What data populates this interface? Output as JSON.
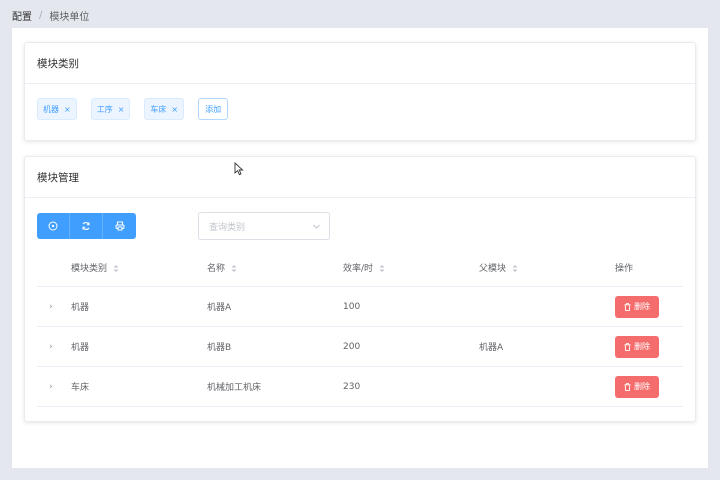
{
  "breadcrumb": {
    "root": "配置",
    "separator": "/",
    "current": "模块单位"
  },
  "category_card": {
    "title": "模块类别",
    "tags": [
      "机器",
      "工序",
      "车床"
    ],
    "add_label": "添加"
  },
  "manage_card": {
    "title": "模块管理",
    "toolbar": {
      "icons": [
        "add-icon",
        "refresh-icon",
        "print-icon"
      ]
    },
    "search": {
      "placeholder": "查询类别"
    },
    "columns": [
      "模块类别",
      "名称",
      "效率/时",
      "父模块",
      "操作"
    ],
    "rows": [
      {
        "category": "机器",
        "name": "机器A",
        "efficiency": "100",
        "parent": "",
        "action": "删除"
      },
      {
        "category": "机器",
        "name": "机器B",
        "efficiency": "200",
        "parent": "机器A",
        "action": "删除"
      },
      {
        "category": "车床",
        "name": "机械加工机床",
        "efficiency": "230",
        "parent": "",
        "action": "删除"
      }
    ]
  },
  "colors": {
    "primary": "#409eff",
    "danger": "#f56c6c",
    "background": "#e4e8ee"
  }
}
